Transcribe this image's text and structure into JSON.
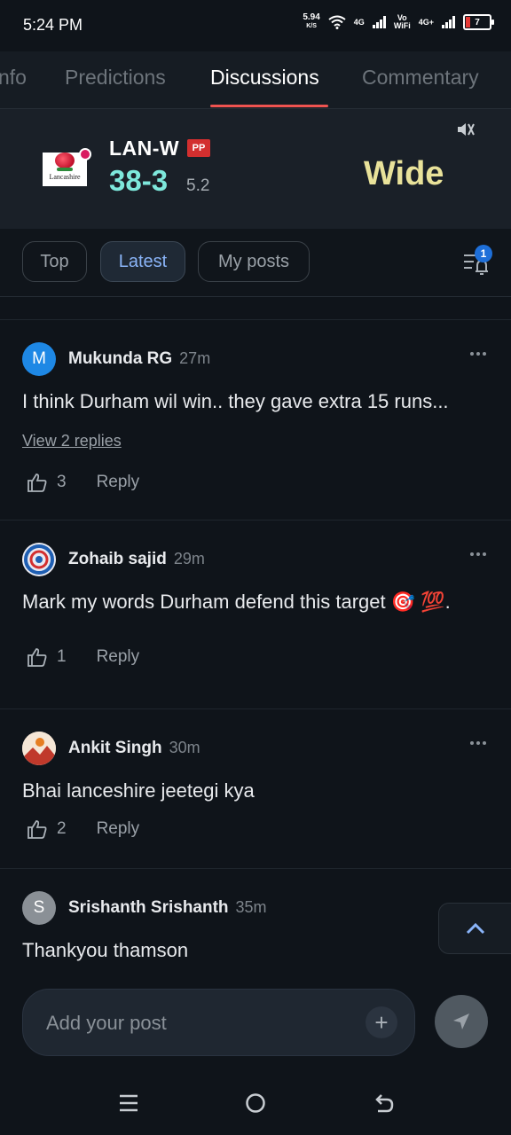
{
  "status_bar": {
    "time": "5:24 PM",
    "net_speed": "5.94",
    "net_speed_unit": "K/S",
    "signal1_label": "4G",
    "vowifi_label_top": "Vo",
    "vowifi_label_bottom": "WiFi",
    "signal2_label": "4G+",
    "battery": "7"
  },
  "tabs": [
    {
      "label": "Info",
      "visible_label": "nfo"
    },
    {
      "label": "Predictions"
    },
    {
      "label": "Discussions",
      "active": true
    },
    {
      "label": "Commentary"
    }
  ],
  "score": {
    "logo_text": "Lancashire",
    "team": "LAN-W",
    "badge": "PP",
    "runs_wickets": "38-3",
    "overs": "5.2",
    "event": "Wide",
    "sound_icon": "mute-icon"
  },
  "filters": {
    "chips": [
      "Top",
      "Latest",
      "My posts"
    ],
    "active": "Latest",
    "notification_count": "1"
  },
  "posts": [
    {
      "avatar_letter": "M",
      "avatar_color": "#1e88e5",
      "author": "Mukunda RG",
      "time": "27m",
      "text": "I think Durham wil win.. they gave extra 15 runs...",
      "replies_label": "View 2 replies",
      "likes": "3",
      "reply_label": "Reply"
    },
    {
      "avatar_type": "spiral-image",
      "author": "Zohaib sajid",
      "time": "29m",
      "text": "Mark my words Durham defend this target 🎯 💯.",
      "likes": "1",
      "reply_label": "Reply"
    },
    {
      "avatar_type": "photo",
      "author": "Ankit Singh",
      "time": "30m",
      "text": "Bhai lanceshire jeetegi kya",
      "likes": "2",
      "reply_label": "Reply"
    },
    {
      "avatar_letter": "S",
      "avatar_color": "#8a9096",
      "author": "Srishanth Srishanth",
      "time": "35m",
      "text": "Thankyou thamson"
    }
  ],
  "composer": {
    "placeholder": "Add your post",
    "plus_label": "+"
  },
  "colors": {
    "background": "#0f141a",
    "accent_underline": "#ef5350",
    "score_color": "#7ee8dc",
    "event_color": "#e9e29a",
    "active_chip_text": "#8ab4f8"
  }
}
